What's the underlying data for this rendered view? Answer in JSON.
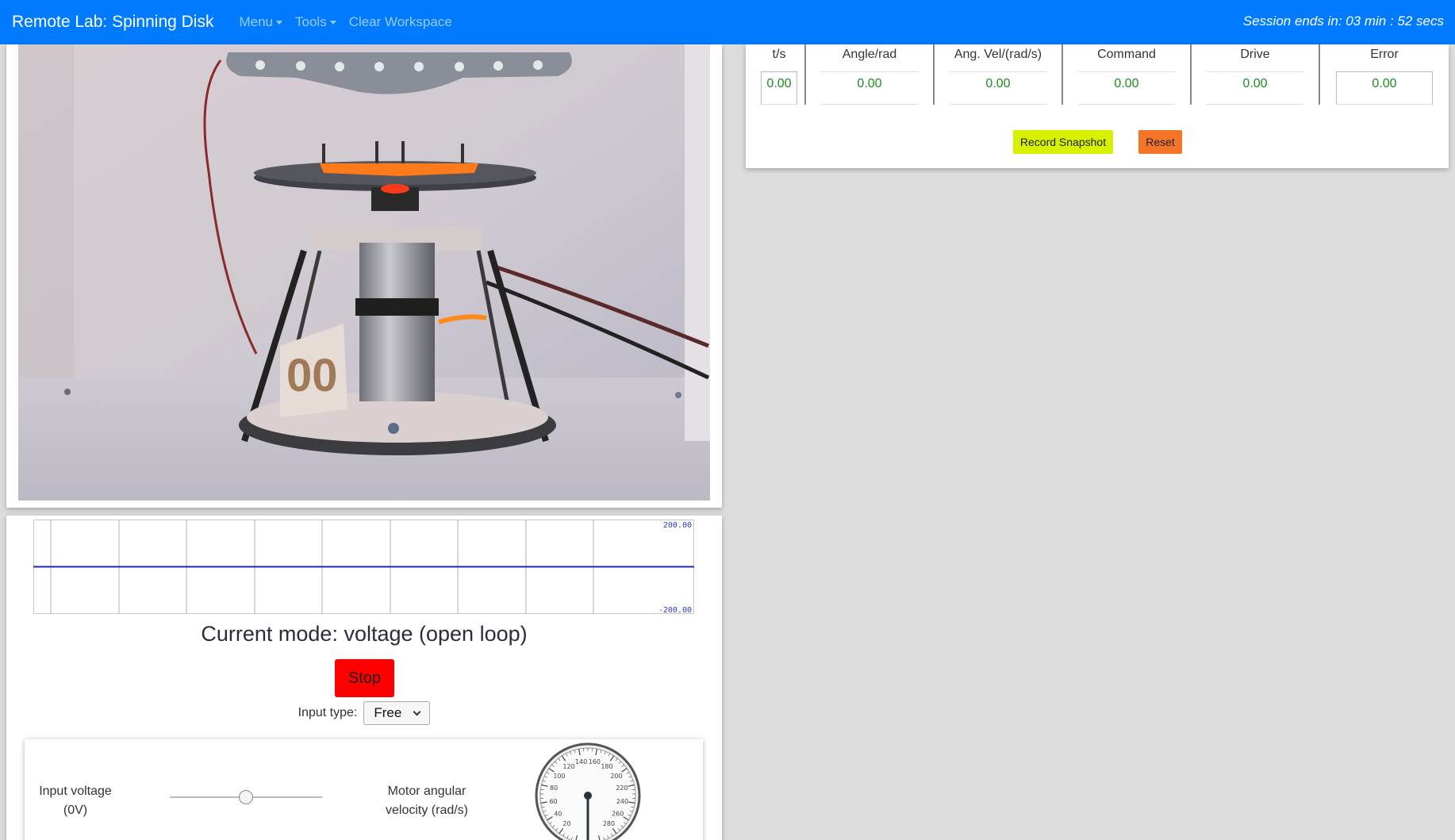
{
  "navbar": {
    "brand": "Remote Lab: Spinning Disk",
    "menu_label": "Menu",
    "tools_label": "Tools",
    "clear_label": "Clear Workspace",
    "session_text": "Session ends in: 03 min : 52 secs"
  },
  "data_table": {
    "columns": [
      {
        "label": "t/s",
        "value": "0.00"
      },
      {
        "label": "Angle/rad",
        "value": "0.00"
      },
      {
        "label": "Ang. Vel/(rad/s)",
        "value": "0.00"
      },
      {
        "label": "Command",
        "value": "0.00"
      },
      {
        "label": "Drive",
        "value": "0.00"
      },
      {
        "label": "Error",
        "value": "0.00"
      }
    ],
    "record_label": "Record Snapshot",
    "reset_label": "Reset"
  },
  "plot": {
    "max_label": "200.00",
    "min_label": "-200.00",
    "value": 0
  },
  "mode_text": "Current mode: voltage (open loop)",
  "stop_label": "Stop",
  "input_type_label": "Input type:",
  "input_type_value": "Free",
  "controls": {
    "voltage_label_line1": "Input voltage",
    "voltage_label_line2": "(0V)",
    "velocity_label_line1": "Motor angular",
    "velocity_label_line2": "velocity (rad/s)",
    "slider_value": 0.5,
    "gauge_ticks": [
      "20",
      "40",
      "60",
      "80",
      "100",
      "120",
      "140",
      "160",
      "180",
      "200",
      "220",
      "240",
      "260",
      "280"
    ]
  },
  "colors": {
    "navbar": "#007bff",
    "record": "#d6f000",
    "reset": "#f57528",
    "stop": "#ff0000",
    "value_text": "#1e8c1e",
    "plot_line": "#1a2cb0"
  }
}
